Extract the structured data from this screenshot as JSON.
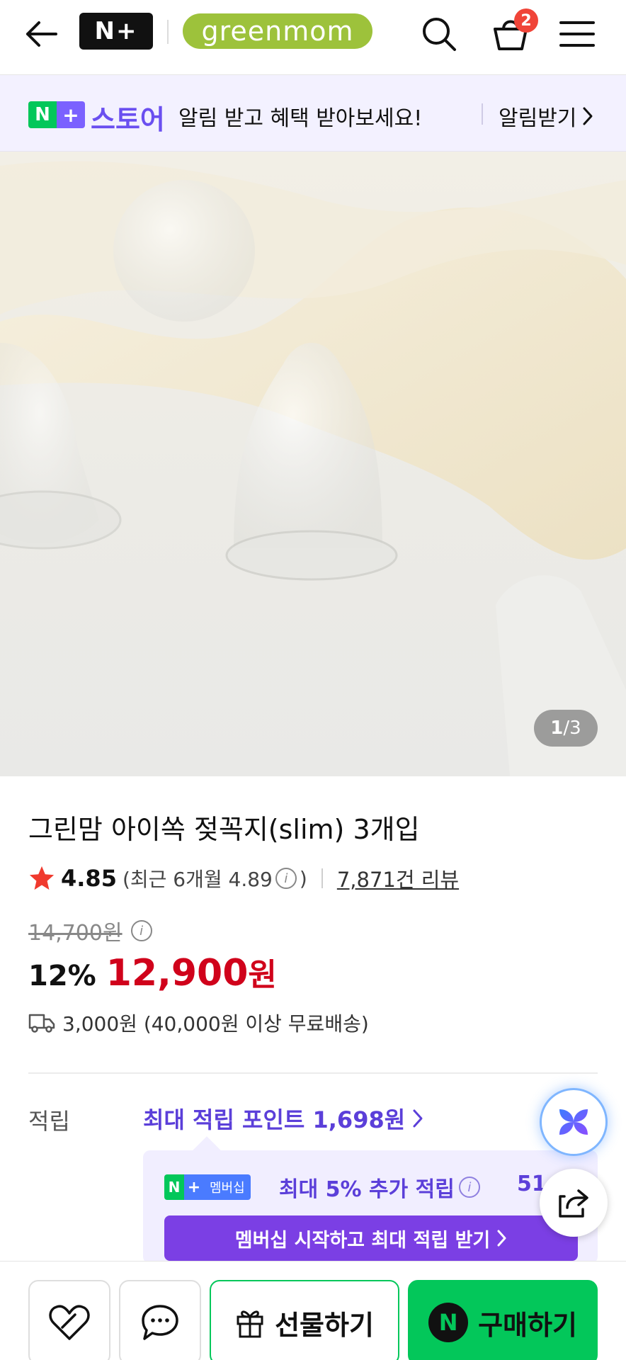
{
  "header": {
    "nplus_logo": "N+",
    "brand_logo": "greenmom",
    "cart_count": "2"
  },
  "store_banner": {
    "badge": "N+",
    "store_label": "스토어",
    "message": "알림 받고 혜택 받아보세요!",
    "action_label": "알림받기"
  },
  "gallery": {
    "current": "1",
    "separator": "/",
    "total": "3"
  },
  "product": {
    "title": "그린맘 아이쏙 젖꼭지(slim) 3개입",
    "rating": "4.85",
    "recent_rating_prefix": "(최근 6개월 4.89",
    "recent_rating_suffix": ")",
    "review_count": "7,871건 리뷰",
    "original_price": "14,700원",
    "discount_rate": "12%",
    "sale_price": "12,900",
    "price_unit": "원",
    "shipping": "3,000원 (40,000원 이상 무료배송)"
  },
  "points": {
    "label": "적립",
    "link": "최대 적립 포인트 1,698원",
    "membership_badge": "멤버십",
    "membership_text": "최대 5% 추가 적립",
    "membership_amount": "51",
    "membership_cta": "멤버십 시작하고 최대 적립 받기"
  },
  "bottom_bar": {
    "gift_label": "선물하기",
    "buy_label": "구매하기",
    "buy_badge": "N"
  },
  "colors": {
    "accent_green": "#03c75a",
    "accent_purple": "#5b3fd9",
    "price_red": "#d0021b",
    "brand_green": "#9dc23b"
  },
  "icons": [
    "back-arrow-icon",
    "search-icon",
    "cart-icon",
    "menu-icon",
    "chevron-right-icon",
    "star-icon",
    "info-icon",
    "truck-icon",
    "ai-sparkle-icon",
    "share-icon",
    "heart-icon",
    "chat-icon",
    "gift-icon"
  ]
}
